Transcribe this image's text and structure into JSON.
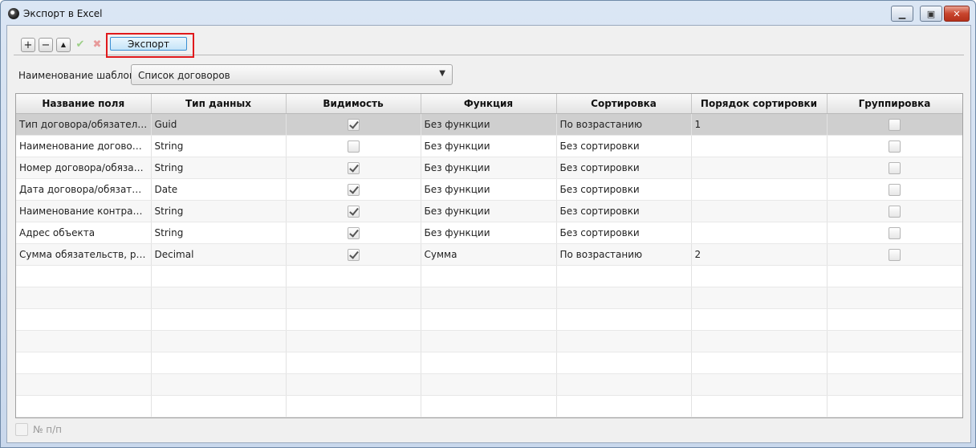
{
  "window": {
    "title": "Экспорт в Excel"
  },
  "toolbar": {
    "export_label": "Экспорт"
  },
  "icons": {
    "add": "plus-icon",
    "remove": "minus-icon",
    "up": "arrow-up-icon",
    "apply": "check-icon",
    "cancel": "cross-icon",
    "add_glyph": "+",
    "remove_glyph": "−",
    "up_glyph": "▲",
    "apply_glyph": "✔",
    "cancel_glyph": "✖",
    "minimize_glyph": "▁",
    "maximize_glyph": "▣",
    "close_glyph": "✕"
  },
  "template": {
    "label": "Наименование шаблона",
    "value": "Список договоров",
    "arrow": "▼"
  },
  "grid": {
    "columns": [
      "Название поля",
      "Тип данных",
      "Видимость",
      "Функция",
      "Сортировка",
      "Порядок сортировки",
      "Группировка"
    ],
    "rows": [
      {
        "name": "Тип договора/обязательства",
        "type": "Guid",
        "visible": true,
        "function": "Без функции",
        "sort": "По возрастанию",
        "order": "1",
        "group": false
      },
      {
        "name": "Наименование договора/о...",
        "type": "String",
        "visible": false,
        "function": "Без функции",
        "sort": "Без сортировки",
        "order": "",
        "group": false
      },
      {
        "name": "Номер договора/обязатель...",
        "type": "String",
        "visible": true,
        "function": "Без функции",
        "sort": "Без сортировки",
        "order": "",
        "group": false
      },
      {
        "name": "Дата договора/обязательст...",
        "type": "Date",
        "visible": true,
        "function": "Без функции",
        "sort": "Без сортировки",
        "order": "",
        "group": false
      },
      {
        "name": "Наименование контрагента",
        "type": "String",
        "visible": true,
        "function": "Без функции",
        "sort": "Без сортировки",
        "order": "",
        "group": false
      },
      {
        "name": "Адрес объекта",
        "type": "String",
        "visible": true,
        "function": "Без функции",
        "sort": "Без сортировки",
        "order": "",
        "group": false
      },
      {
        "name": "Сумма обязательств, руб.",
        "type": "Decimal",
        "visible": true,
        "function": "Сумма",
        "sort": "По возрастанию",
        "order": "2",
        "group": false
      }
    ],
    "selected_row": 0
  },
  "footer": {
    "numbering_label": "№ п/п",
    "numbering_checked": false
  }
}
